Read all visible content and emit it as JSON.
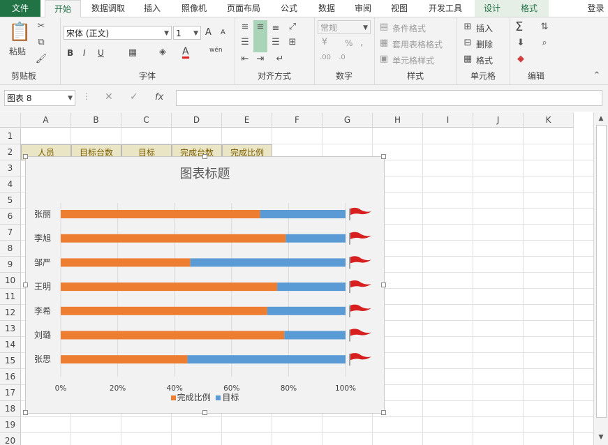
{
  "tabs": [
    "文件",
    "开始",
    "数据调取",
    "插入",
    "照像机",
    "页面布局",
    "公式",
    "数据",
    "审阅",
    "视图",
    "开发工具",
    "设计",
    "格式"
  ],
  "login": "登录",
  "ribbon": {
    "clipboard": {
      "paste": "粘贴",
      "label": "剪贴板"
    },
    "font": {
      "name": "宋体 (正文)",
      "size": "1",
      "bold": "B",
      "italic": "I",
      "underline": "U",
      "grow": "A",
      "shrink": "A",
      "color": "A",
      "wen": "wén",
      "label": "字体"
    },
    "align": {
      "label": "对齐方式"
    },
    "number": {
      "format": "常规",
      "percent": "%",
      "comma": ",",
      "label": "数字"
    },
    "styles": {
      "cond": "条件格式",
      "table": "套用表格格式",
      "cell": "单元格样式",
      "label": "样式"
    },
    "cells": {
      "insert": "插入",
      "delete": "删除",
      "format": "格式",
      "label": "单元格"
    },
    "edit": {
      "sum": "Σ",
      "label": "编辑"
    }
  },
  "formula_bar": {
    "namebox": "图表 8",
    "fx": "fx",
    "value": ""
  },
  "columns": [
    "A",
    "B",
    "C",
    "D",
    "E",
    "F",
    "G",
    "H",
    "I",
    "J",
    "K"
  ],
  "rows": [
    "1",
    "2",
    "3",
    "4",
    "5",
    "6",
    "7",
    "8",
    "9",
    "10",
    "11",
    "12",
    "13",
    "14",
    "15",
    "16",
    "17",
    "18",
    "19",
    "20"
  ],
  "header_cells": [
    "人员",
    "目标台数",
    "目标",
    "完成台数",
    "完成比例"
  ],
  "chart_data": {
    "type": "bar",
    "stacked": true,
    "title": "图表标题",
    "categories": [
      "张丽",
      "李旭",
      "邹严",
      "王明",
      "李希",
      "刘璐",
      "张思"
    ],
    "series": [
      {
        "name": "完成比例",
        "color": "#ed7d31",
        "values": [
          0.7,
          0.79,
          0.455,
          0.76,
          0.725,
          0.785,
          0.445
        ]
      },
      {
        "name": "目标",
        "color": "#5b9bd5",
        "values": [
          0.3,
          0.21,
          0.545,
          0.24,
          0.275,
          0.215,
          0.555
        ]
      }
    ],
    "xlim": [
      0,
      1
    ],
    "ticks": [
      "0%",
      "20%",
      "40%",
      "60%",
      "80%",
      "100%"
    ],
    "grid": true,
    "legend": "bottom",
    "marker": "red-flag-icon"
  }
}
